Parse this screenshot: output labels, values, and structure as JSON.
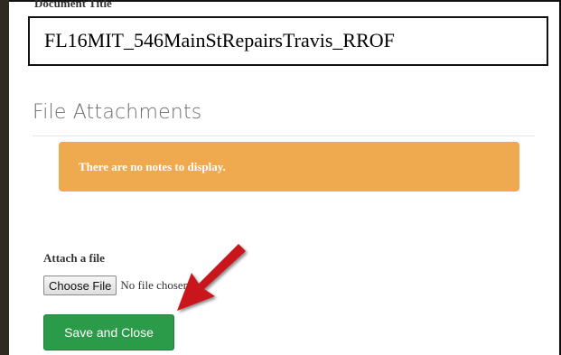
{
  "document": {
    "title_label": "Document Title",
    "title_value": "FL16MIT_546MainStRepairsTravis_RROF"
  },
  "attachments": {
    "heading": "File Attachments",
    "empty_notice": "There are no notes to display."
  },
  "upload": {
    "label": "Attach a file",
    "choose_label": "Choose File",
    "no_file_text": "No file chosen"
  },
  "actions": {
    "save_close_label": "Save and Close"
  },
  "colors": {
    "alert_bg": "#efaa4f",
    "save_button_bg": "#2b9a49",
    "annotation_arrow": "#c8161d"
  },
  "icons": {
    "annotation": "red-arrow-icon"
  }
}
